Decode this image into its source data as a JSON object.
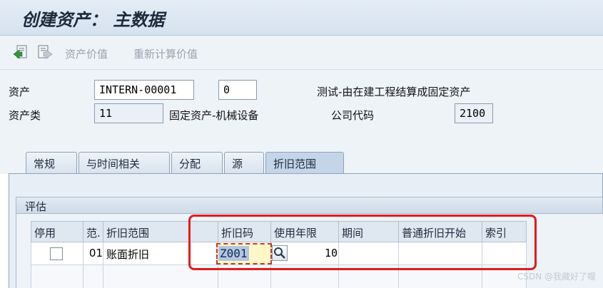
{
  "window": {
    "title": "创建资产： 主数据"
  },
  "toolbar": {
    "asset_values": "资产价值",
    "recalc_values": "重新计算价值"
  },
  "header": {
    "asset_label": "资产",
    "asset_number": "INTERN-00001",
    "subnumber": "0",
    "description": "测试-由在建工程结算成固定资产",
    "class_label": "资产类",
    "class_value": "11",
    "class_description": "固定资产-机械设备",
    "company_code_label": "公司代码",
    "company_code_value": "2100"
  },
  "tabs": [
    {
      "label": "常规"
    },
    {
      "label": "与时间相关"
    },
    {
      "label": "分配"
    },
    {
      "label": "源"
    },
    {
      "label": "折旧范围",
      "active": true
    }
  ],
  "valuation": {
    "group_title": "评估",
    "columns": [
      "停用",
      "范.",
      "折旧范围",
      "折旧码",
      "使用年限",
      "期间",
      "普通折旧开始",
      "索引"
    ],
    "row": {
      "deactivated": false,
      "area_number": "01",
      "area_name": "账面折旧",
      "dep_key": "Z001",
      "useful_life": "10",
      "period": "",
      "ord_dep_start": "",
      "index": ""
    }
  },
  "watermark": "CSDN @我藏好了喔"
}
